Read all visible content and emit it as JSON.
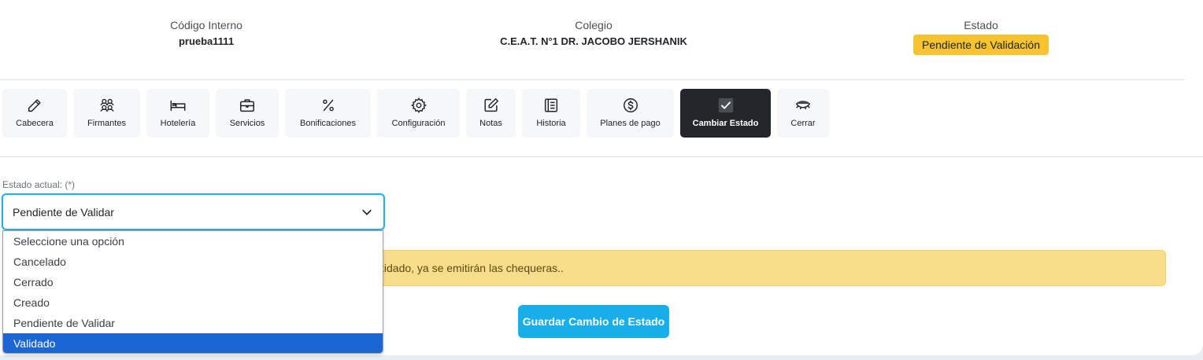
{
  "header": {
    "codigo": {
      "label": "Código Interno",
      "value": "prueba1111"
    },
    "colegio": {
      "label": "Colegio",
      "value": "C.E.A.T. N°1 DR. JACOBO JERSHANIK"
    },
    "estado": {
      "label": "Estado",
      "badge": "Pendiente de Validación"
    }
  },
  "tabs": [
    {
      "label": "Cabecera",
      "icon": "pencil-icon"
    },
    {
      "label": "Firmantes",
      "icon": "users-icon"
    },
    {
      "label": "Hotelería",
      "icon": "bed-icon"
    },
    {
      "label": "Servicios",
      "icon": "briefcase-icon"
    },
    {
      "label": "Bonificaciones",
      "icon": "percent-icon"
    },
    {
      "label": "Configuración",
      "icon": "gear-icon"
    },
    {
      "label": "Notas",
      "icon": "edit-note-icon"
    },
    {
      "label": "Historia",
      "icon": "journal-icon"
    },
    {
      "label": "Planes de pago",
      "icon": "dollar-circle-icon"
    },
    {
      "label": "Cambiar Estado",
      "icon": "check-icon",
      "active": true
    },
    {
      "label": "Cerrar",
      "icon": "eye-closed-icon"
    }
  ],
  "form": {
    "label": "Estado actual: (*)",
    "selected": "Pendiente de Validar",
    "options": [
      "Seleccione una opción",
      "Cancelado",
      "Cerrado",
      "Creado",
      "Pendiente de Validar",
      "Validado"
    ],
    "highlighted_option": "Validado"
  },
  "alert": {
    "text": "tidado, ya se emitirán las chequeras.."
  },
  "save_button": "Guardar Cambio de Estado",
  "colors": {
    "accent": "#18aee9",
    "badge": "#f7c32e",
    "alert": "#f8de8a",
    "active_tab": "#23272b",
    "highlight": "#1a66d2"
  }
}
